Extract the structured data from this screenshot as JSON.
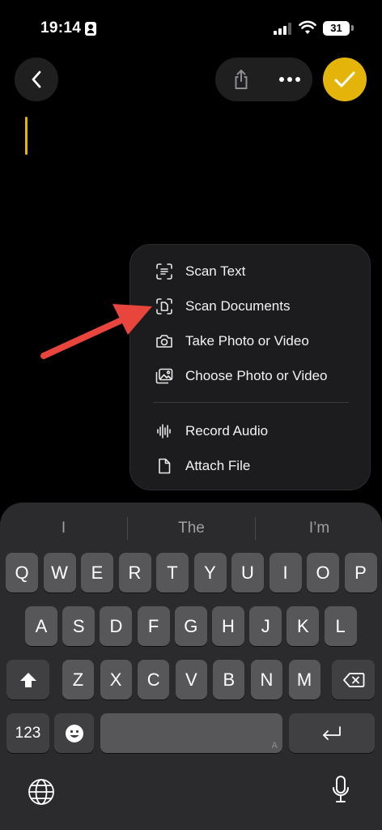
{
  "status_bar": {
    "time": "19:14",
    "battery": "31"
  },
  "nav": {
    "back_icon": "chevron-left-icon",
    "share_icon": "share-icon",
    "more_icon": "ellipsis-icon",
    "done_icon": "checkmark-icon",
    "accent_color": "#e5b40b"
  },
  "attach_menu": {
    "items": [
      {
        "label": "Scan Text",
        "icon": "scan-text-icon"
      },
      {
        "label": "Scan Documents",
        "icon": "scan-document-icon"
      },
      {
        "label": "Take Photo or Video",
        "icon": "camera-icon"
      },
      {
        "label": "Choose Photo or Video",
        "icon": "photo-library-icon"
      },
      {
        "label": "Record Audio",
        "icon": "waveform-icon"
      },
      {
        "label": "Attach File",
        "icon": "document-icon"
      }
    ],
    "annotation_color": "#e8453c"
  },
  "keyboard": {
    "suggestions": [
      "I",
      "The",
      "I’m"
    ],
    "rows": [
      [
        "Q",
        "W",
        "E",
        "R",
        "T",
        "Y",
        "U",
        "I",
        "O",
        "P"
      ],
      [
        "A",
        "S",
        "D",
        "F",
        "G",
        "H",
        "J",
        "K",
        "L"
      ],
      [
        "Z",
        "X",
        "C",
        "V",
        "B",
        "N",
        "M"
      ]
    ],
    "numbers_key": "123",
    "space_mark": "A",
    "shift_icon": "shift-icon",
    "delete_icon": "delete-icon",
    "emoji_icon": "emoji-icon",
    "return_icon": "return-icon",
    "globe_icon": "globe-icon",
    "mic_icon": "microphone-icon"
  }
}
